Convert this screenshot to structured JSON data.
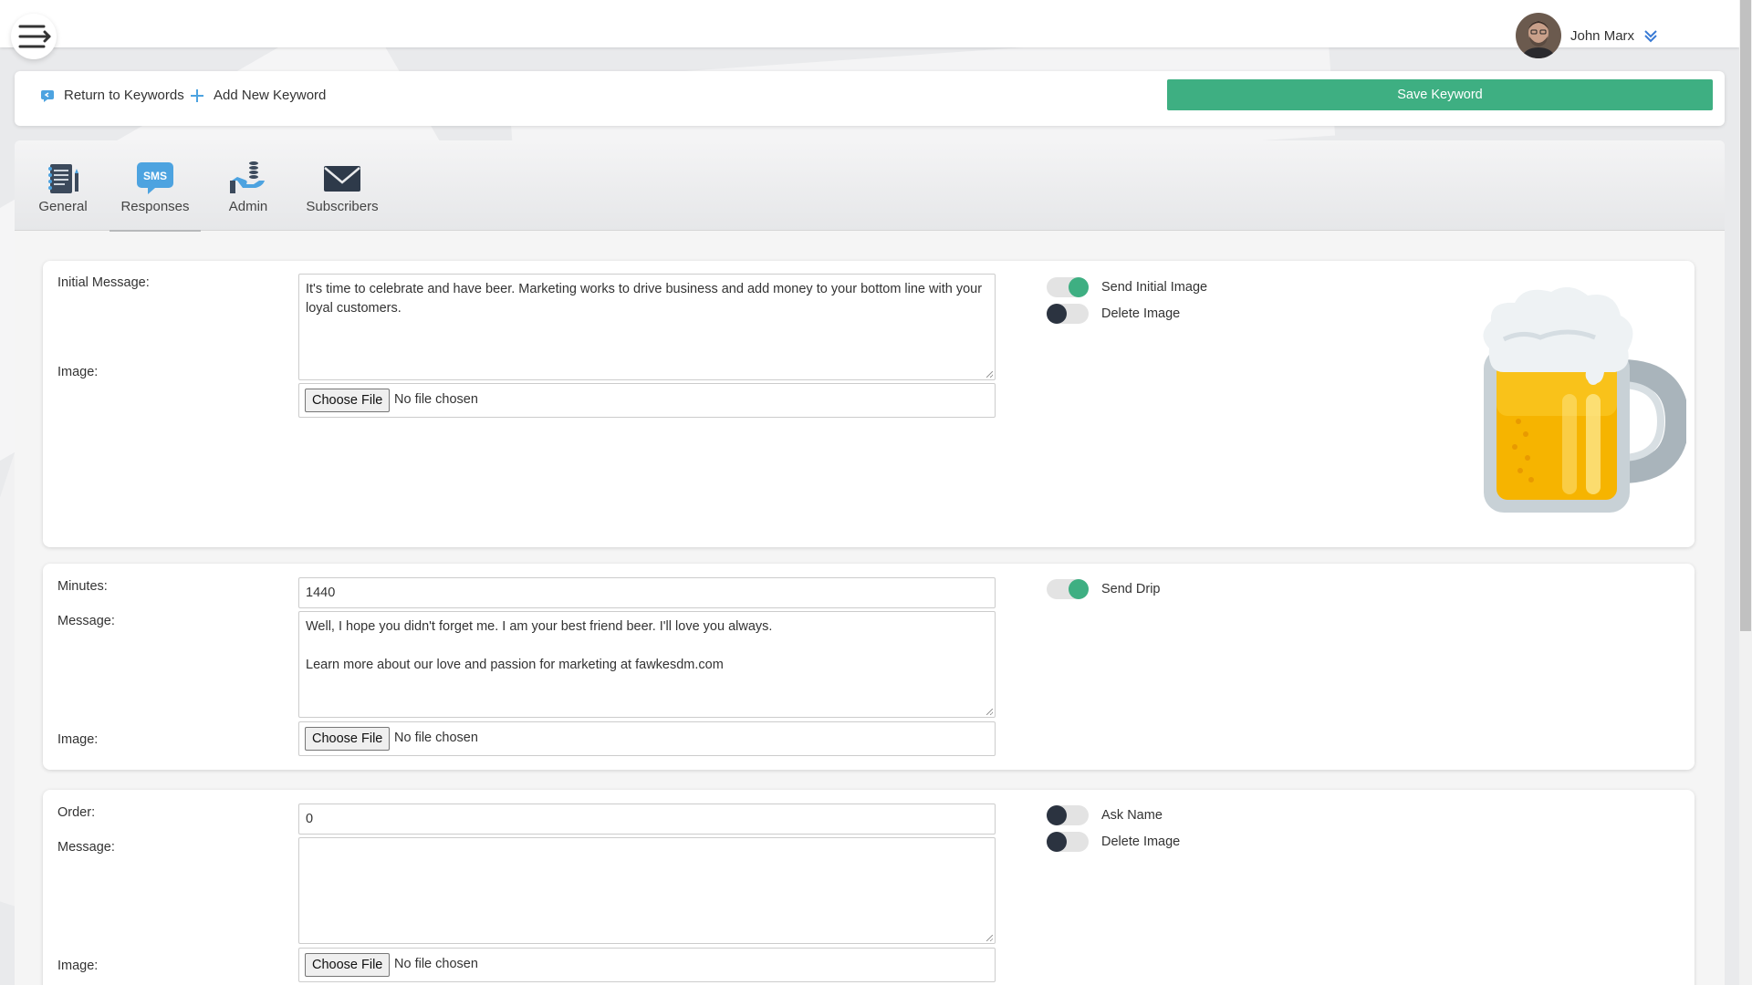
{
  "header": {
    "user_name": "John Marx"
  },
  "actions": {
    "return_label": "Return to Keywords",
    "add_label": "Add New Keyword",
    "save_label": "Save Keyword"
  },
  "tabs": [
    {
      "label": "General",
      "icon": "notebook-icon"
    },
    {
      "label": "Responses",
      "icon": "sms-icon"
    },
    {
      "label": "Admin",
      "icon": "admin-hand-icon"
    },
    {
      "label": "Subscribers",
      "icon": "envelope-icon"
    }
  ],
  "active_tab": "Responses",
  "initial": {
    "message_label": "Initial Message:",
    "message_value": "It's time to celebrate and have beer. Marketing works to drive business and add money to your bottom line with your loyal customers.",
    "image_label": "Image:",
    "choose_label": "Choose File",
    "file_status": "No file chosen",
    "toggle_send_image": {
      "label": "Send Initial Image",
      "on": true
    },
    "toggle_delete_image": {
      "label": "Delete Image",
      "on": false
    },
    "preview": "beer-mug-image"
  },
  "drip": {
    "minutes_label": "Minutes:",
    "minutes_value": "1440",
    "message_label": "Message:",
    "message_value": "Well, I hope you didn't forget me. I am your best friend beer. I'll love you always.\n\nLearn more about our love and passion for marketing at fawkesdm.com",
    "image_label": "Image:",
    "choose_label": "Choose File",
    "file_status": "No file chosen",
    "toggle_send_drip": {
      "label": "Send Drip",
      "on": true
    }
  },
  "order": {
    "order_label": "Order:",
    "order_value": "0",
    "message_label": "Message:",
    "message_value": "",
    "image_label": "Image:",
    "choose_label": "Choose File",
    "file_status": "No file chosen",
    "toggle_ask_name": {
      "label": "Ask Name",
      "on": false
    },
    "toggle_delete_image": {
      "label": "Delete Image",
      "on": false
    }
  },
  "colors": {
    "accent_green": "#3eaf82",
    "toggle_off_knob": "#2b3340",
    "sms_blue": "#4da3e0"
  }
}
